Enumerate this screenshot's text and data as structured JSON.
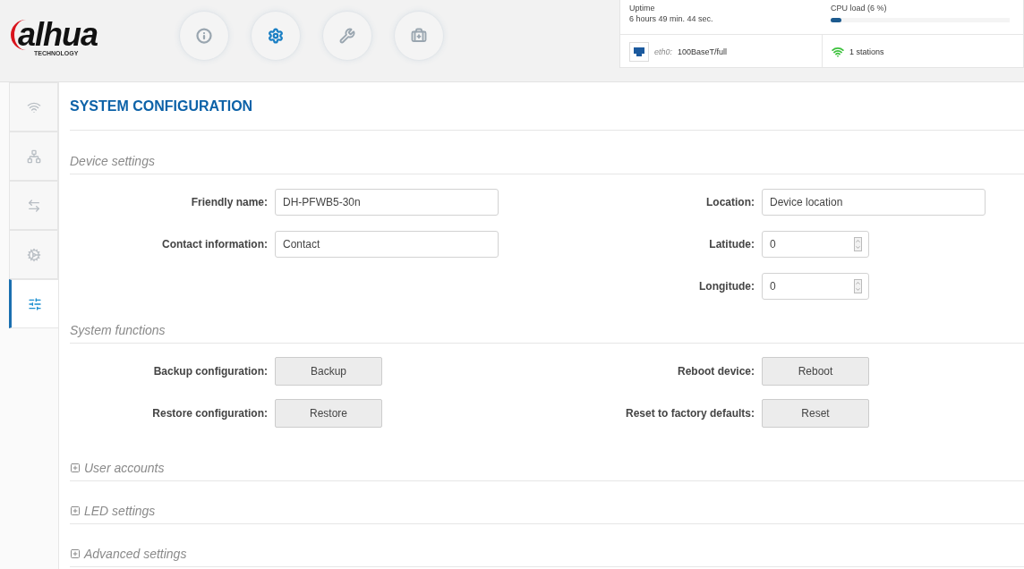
{
  "logo": {
    "wordmark": "alhua",
    "tagline": "TECHNOLOGY"
  },
  "nav": [
    {
      "kind": "info",
      "selected": false
    },
    {
      "kind": "settings",
      "selected": true
    },
    {
      "kind": "tools",
      "selected": false
    },
    {
      "kind": "support",
      "selected": false
    }
  ],
  "status": {
    "uptime_label": "Uptime",
    "uptime_value": "6 hours 49 min. 44 sec.",
    "cpu_label": "CPU load (6 %)",
    "cpu": {
      "level": 0.06
    },
    "interface_name": "eth0:",
    "interface_value": "100BaseT/full",
    "stations": "1 stations"
  },
  "sidebar": [
    {
      "kind": "wireless",
      "selected": false
    },
    {
      "kind": "network",
      "selected": false
    },
    {
      "kind": "routing",
      "selected": false
    },
    {
      "kind": "services",
      "selected": false
    },
    {
      "kind": "system",
      "selected": true
    }
  ],
  "title": "SYSTEM CONFIGURATION",
  "device_settings": {
    "heading": "Device settings",
    "left": [
      {
        "label": "Friendly name:",
        "kind": "text",
        "value": "DH-PFWB5-30n"
      },
      {
        "label": "Contact information:",
        "kind": "text",
        "value": "Contact"
      }
    ],
    "right": [
      {
        "label": "Location:",
        "kind": "text",
        "value": "Device location"
      },
      {
        "label": "Latitude:",
        "kind": "number",
        "value": "0"
      },
      {
        "label": "Longitude:",
        "kind": "number",
        "value": "0"
      }
    ]
  },
  "system_functions": {
    "heading": "System functions",
    "left": [
      {
        "label": "Backup configuration:",
        "button": "Backup"
      },
      {
        "label": "Restore configuration:",
        "button": "Restore"
      }
    ],
    "right": [
      {
        "label": "Reboot device:",
        "button": "Reboot"
      },
      {
        "label": "Reset to factory defaults:",
        "button": "Reset"
      }
    ]
  },
  "collapsed_sections": [
    {
      "title": "User accounts",
      "expanded": false
    },
    {
      "title": "LED settings",
      "expanded": false
    },
    {
      "title": "Advanced settings",
      "expanded": false
    }
  ]
}
